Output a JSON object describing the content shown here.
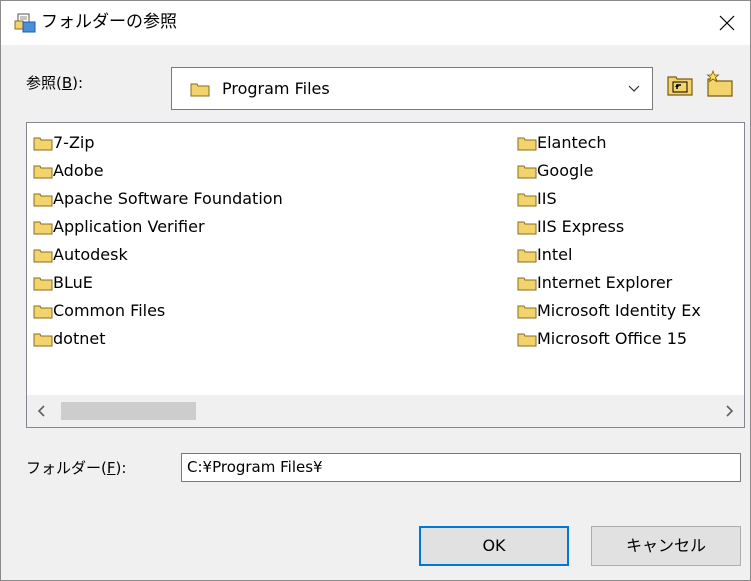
{
  "window": {
    "title": "フォルダーの参照",
    "close_icon": "close-icon"
  },
  "lookin": {
    "label_prefix": "参照(",
    "label_key": "B",
    "label_suffix": "):",
    "selected": "Program Files",
    "dropdown_icon": "chevron-down-icon"
  },
  "toolbar": {
    "up_icon": "folder-up-icon",
    "new_icon": "new-folder-icon"
  },
  "folders": {
    "left": [
      "7-Zip",
      "Adobe",
      "Apache Software Foundation",
      "Application Verifier",
      "Autodesk",
      "BLuE",
      "Common Files",
      "dotnet"
    ],
    "right": [
      "Elantech",
      "Google",
      "IIS",
      "IIS Express",
      "Intel",
      "Internet Explorer",
      "Microsoft Identity Ex",
      "Microsoft Office 15"
    ]
  },
  "folder_field": {
    "label_prefix": "フォルダー(",
    "label_key": "F",
    "label_suffix": "):",
    "value": "C:¥Program Files¥"
  },
  "buttons": {
    "ok": "OK",
    "cancel": "キャンセル"
  },
  "colors": {
    "accent": "#0078d7",
    "folder": "#f3d36b"
  }
}
